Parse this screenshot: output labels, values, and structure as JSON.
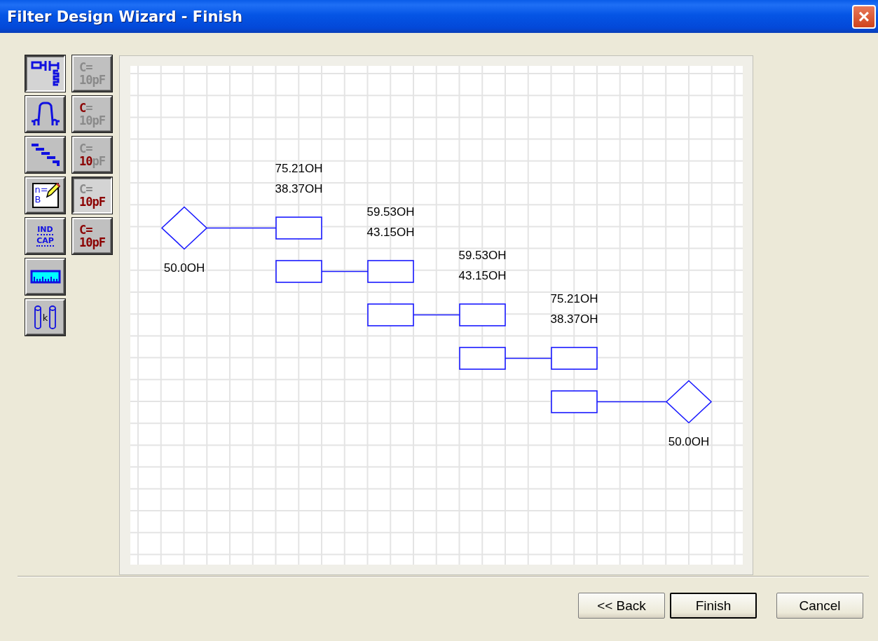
{
  "window": {
    "title": "Filter Design Wizard - Finish",
    "close": "×"
  },
  "tools": [
    {
      "kind": "schematic",
      "selected": true
    },
    {
      "kind": "response",
      "selected": false
    },
    {
      "kind": "steps",
      "selected": false
    },
    {
      "kind": "notes",
      "selected": false,
      "lines": [
        "n=",
        "B"
      ]
    },
    {
      "kind": "indcap",
      "selected": false,
      "lines": [
        "IND",
        "CAP"
      ]
    },
    {
      "kind": "ruler",
      "selected": false
    },
    {
      "kind": "coupling",
      "selected": false,
      "lines": [
        "k"
      ]
    }
  ],
  "unit_tools": [
    {
      "selected": false,
      "parts": [
        {
          "text": "C=",
          "highlighted": false
        },
        {
          "text": "10",
          "highlighted": false
        },
        {
          "text": "pF",
          "highlighted": false
        }
      ]
    },
    {
      "selected": false,
      "parts": [
        {
          "text": "C",
          "highlighted": true
        },
        {
          "text": "=",
          "highlighted": false
        },
        {
          "text": "10",
          "highlighted": false
        },
        {
          "text": "pF",
          "highlighted": false
        }
      ]
    },
    {
      "selected": false,
      "parts": [
        {
          "text": "C=",
          "highlighted": false
        },
        {
          "text": "10",
          "highlighted": true
        },
        {
          "text": "pF",
          "highlighted": false
        }
      ]
    },
    {
      "selected": true,
      "parts": [
        {
          "text": "C=",
          "highlighted": false
        },
        {
          "text": "10",
          "highlighted": true
        },
        {
          "text": "pF",
          "highlighted": true
        }
      ]
    },
    {
      "selected": false,
      "parts": [
        {
          "text": "C=",
          "highlighted": true
        },
        {
          "text": "10",
          "highlighted": true
        },
        {
          "text": "pF",
          "highlighted": true
        }
      ]
    }
  ],
  "schematic": {
    "ports": [
      {
        "label": "50.0OH"
      },
      {
        "label": "50.0OH"
      }
    ],
    "sections": [
      {
        "line_1": "75.21OH",
        "line_2": "38.37OH"
      },
      {
        "line_1": "59.53OH",
        "line_2": "43.15OH"
      },
      {
        "line_1": "59.53OH",
        "line_2": "43.15OH"
      },
      {
        "line_1": "75.21OH",
        "line_2": "38.37OH"
      }
    ]
  },
  "buttons": [
    {
      "label": "<< Back",
      "default": false
    },
    {
      "label": "Finish",
      "default": true
    },
    {
      "label": "Cancel",
      "default": false
    }
  ]
}
